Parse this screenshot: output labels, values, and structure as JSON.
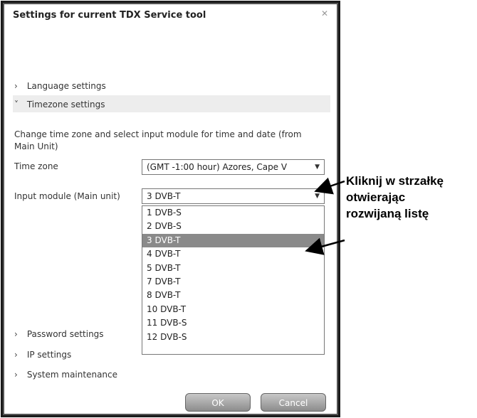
{
  "dialog": {
    "title": "Settings for current TDX Service tool",
    "close_icon": "close-icon"
  },
  "sections": {
    "language": "Language settings",
    "timezone": "Timezone settings",
    "password": "Password settings",
    "ip": "IP settings",
    "system": "System maintenance"
  },
  "timezone": {
    "description": "Change time zone and select input module for time and date (from Main Unit)",
    "time_zone_label": "Time zone",
    "time_zone_value": "(GMT -1:00 hour) Azores, Cape V",
    "input_module_label": "Input module (Main unit)",
    "input_module_value": "3 DVB-T",
    "options": [
      "1 DVB-S",
      "2 DVB-S",
      "3 DVB-T",
      "4 DVB-T",
      "5 DVB-T",
      "7 DVB-T",
      "8 DVB-T",
      "10 DVB-T",
      "11 DVB-S",
      "12 DVB-S"
    ],
    "selected_index": 2
  },
  "buttons": {
    "ok": "OK",
    "cancel": "Cancel"
  },
  "annotation": {
    "line1": "Kliknij w strzałkę",
    "line2": "otwierając",
    "line3": "rozwijaną listę"
  }
}
